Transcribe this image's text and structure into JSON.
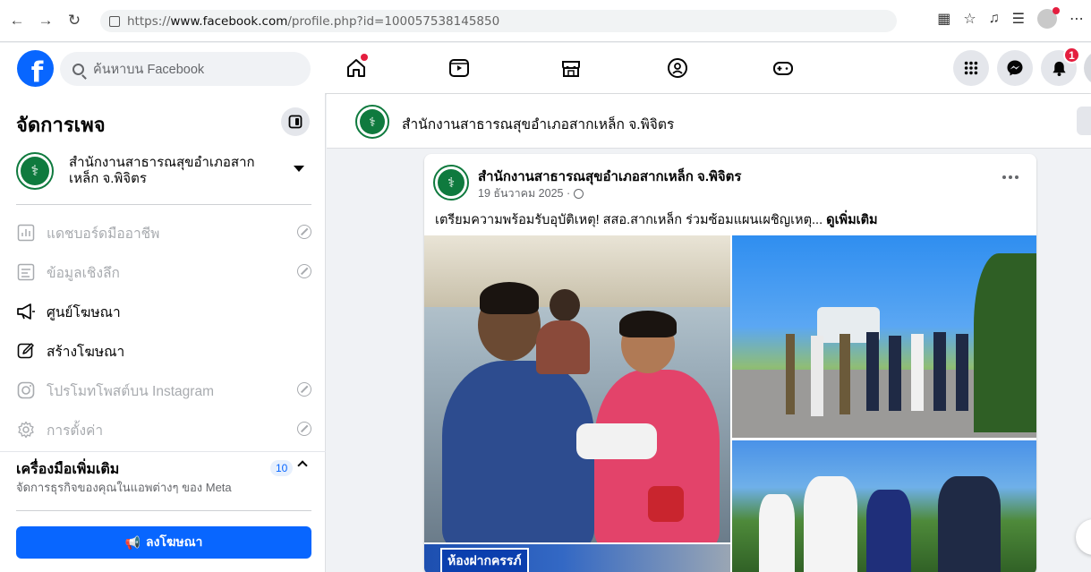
{
  "browser": {
    "url_prefix": "https://",
    "url_domain": "www.facebook.com",
    "url_path": "/profile.php?id=100057538145850"
  },
  "facebook": {
    "search_placeholder": "ค้นหาบน Facebook",
    "notification_count": "1"
  },
  "sidebar": {
    "title": "จัดการเพจ",
    "page_name": "สำนักงานสาธารณสุขอำเภอสากเหล็ก จ.พิจิตร",
    "items": [
      {
        "label": "แดชบอร์ดมืออาชีพ",
        "enabled": false,
        "icon": "dashboard-icon"
      },
      {
        "label": "ข้อมูลเชิงลึก",
        "enabled": false,
        "icon": "insights-icon"
      },
      {
        "label": "ศูนย์โฆษณา",
        "enabled": true,
        "icon": "megaphone-icon"
      },
      {
        "label": "สร้างโฆษณา",
        "enabled": true,
        "icon": "edit-icon"
      },
      {
        "label": "โปรโมทโพสต์บน Instagram",
        "enabled": false,
        "icon": "instagram-icon"
      },
      {
        "label": "การตั้งค่า",
        "enabled": false,
        "icon": "gear-icon"
      }
    ],
    "tools_title": "เครื่องมือเพิ่มเติม",
    "tools_subtitle": "จัดการธุรกิจของคุณในแอพต่างๆ ของ Meta",
    "tools_count": "10",
    "ad_button": "ลงโฆษณา"
  },
  "page_header": {
    "name": "สำนักงานสาธารณสุขอำเภอสากเหล็ก จ.พิจิตร"
  },
  "post": {
    "author": "สำนักงานสาธารณสุขอำเภอสากเหล็ก จ.พิจิตร",
    "date": "19 ธันวาคม 2025 ·",
    "text": "เตรียมความพร้อมรับอุบัติเหตุ! สสอ.สากเหล็ก ร่วมซ้อมแผนเผชิญเหตุ...",
    "see_more": "ดูเพิ่มเติม",
    "photo_sign": "ห้องฝากครรภ์"
  },
  "colors": {
    "facebook_blue": "#0866ff",
    "page_green": "#0f7a3e",
    "notification_red": "#e41e3f"
  }
}
